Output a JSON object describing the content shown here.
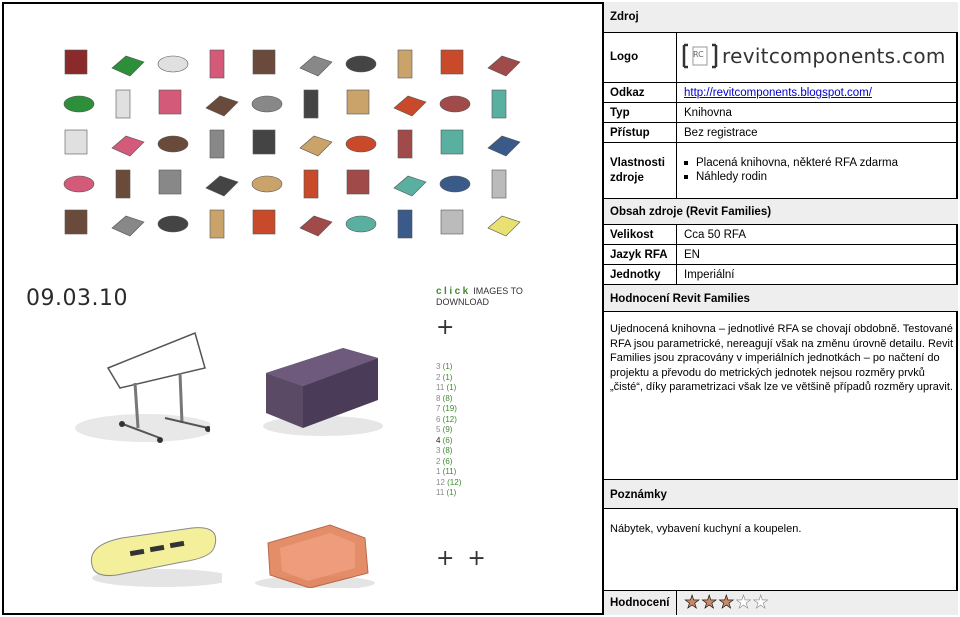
{
  "screenshot": {
    "date": "09.03.10",
    "click_word": "click",
    "click_rest": " IMAGES TO DOWNLOAD",
    "plus_single": "+",
    "plus_double": "+ +",
    "pages": [
      {
        "n": "3",
        "c": "(1)"
      },
      {
        "n": "2",
        "c": "(1)"
      },
      {
        "n": "11",
        "c": "(1)"
      },
      {
        "n": "8",
        "c": "(8)"
      },
      {
        "n": "7",
        "c": "(19)"
      },
      {
        "n": "6",
        "c": "(12)"
      },
      {
        "n": "5",
        "c": "(9)"
      },
      {
        "n": "4",
        "c": "(6)",
        "active": true
      },
      {
        "n": "3",
        "c": "(8)"
      },
      {
        "n": "2",
        "c": "(6)"
      },
      {
        "n": "1",
        "c": "(11)"
      },
      {
        "n": "12",
        "c": "(12)"
      },
      {
        "n": "11",
        "c": "(1)"
      }
    ]
  },
  "table": {
    "header": "Zdroj",
    "logo_label": "Logo",
    "logo_text": "revitcomponents.com",
    "logo_mark": "RC",
    "link_label": "Odkaz",
    "link_value": "http://revitcomponents.blogspot.com/",
    "type_label": "Typ",
    "type_value": "Knihovna",
    "access_label": "Přístup",
    "access_value": "Bez registrace",
    "props_label": "Vlastnosti zdroje",
    "props": [
      "Placená knihovna, některé RFA zdarma",
      "Náhledy rodin"
    ],
    "content_header": "Obsah zdroje (Revit Families)",
    "size_label": "Velikost",
    "size_value": "Cca 50 RFA",
    "lang_label": "Jazyk RFA",
    "lang_value": "EN",
    "units_label": "Jednotky",
    "units_value": "Imperiální",
    "rating_header": "Hodnocení Revit Families",
    "rating_text": "Ujednocená knihovna – jednotlivé RFA se chovají obdobně. Testované RFA jsou parametrické, nereagují však na změnu úrovně detailu. Revit Families jsou zpracovány v imperiálních jednotkách – po načtení do projektu a převodu do metrických jednotek nejsou rozměry prvků „čisté“, díky parametrizaci však lze ve většině případů rozměry upravit.",
    "notes_header": "Poznámky",
    "notes_text": "Nábytek, vybavení kuchyní a koupelen.",
    "score_label": "Hodnocení",
    "score": 3,
    "score_max": 5
  },
  "colors": {
    "shade": "#eeeeee",
    "link": "#0000cc",
    "star_on": "#c98a6a",
    "green": "#3f8a2f"
  },
  "icons": [
    "furniture-thumbnail",
    "star-icon"
  ]
}
